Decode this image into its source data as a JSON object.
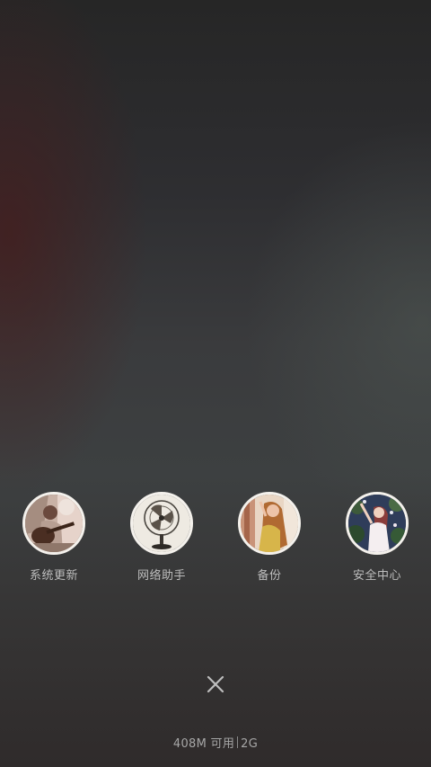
{
  "apps": [
    {
      "label": "系统更新",
      "icon": "guitarist-photo-icon"
    },
    {
      "label": "网络助手",
      "icon": "fan-photo-icon"
    },
    {
      "label": "备份",
      "icon": "girl-photo-icon"
    },
    {
      "label": "安全中心",
      "icon": "girl-garden-photo-icon"
    }
  ],
  "close_icon": "close-icon",
  "status": {
    "memory": "408M 可用",
    "network": "2G"
  }
}
